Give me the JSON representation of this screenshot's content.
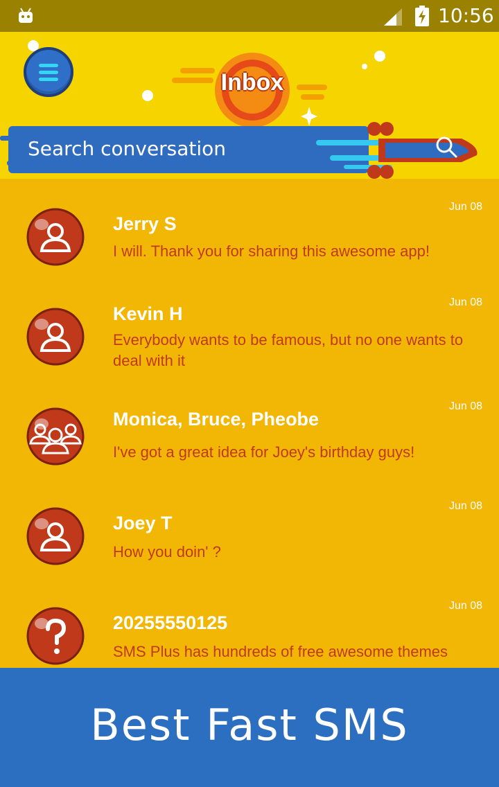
{
  "status_bar": {
    "time": "10:56"
  },
  "header": {
    "title": "Inbox",
    "search_placeholder": "Search conversation"
  },
  "conversations": [
    {
      "name": "Jerry S",
      "preview": "I will. Thank you for sharing this awesome app!",
      "date": "Jun 08",
      "avatar": "person-icon"
    },
    {
      "name": "Kevin H",
      "preview": "Everybody wants to be famous, but no one wants to deal with it",
      "date": "Jun 08",
      "avatar": "person-icon"
    },
    {
      "name": "Monica, Bruce, Pheobe",
      "preview": "I've got a great idea for Joey's birthday guys!",
      "date": "Jun 08",
      "avatar": "group-icon"
    },
    {
      "name": "Joey T",
      "preview": "How you doin' ?",
      "date": "Jun 08",
      "avatar": "person-icon"
    },
    {
      "name": "20255550125",
      "preview": "SMS Plus has hundreds of free awesome themes",
      "date": "Jun 08",
      "avatar": "question-icon"
    }
  ],
  "banner": {
    "text": "Best Fast SMS"
  },
  "colors": {
    "header_yellow": "#f6d400",
    "list_yellow": "#f2b705",
    "avatar_red": "#c0391b",
    "banner_blue": "#2c6fc0"
  }
}
